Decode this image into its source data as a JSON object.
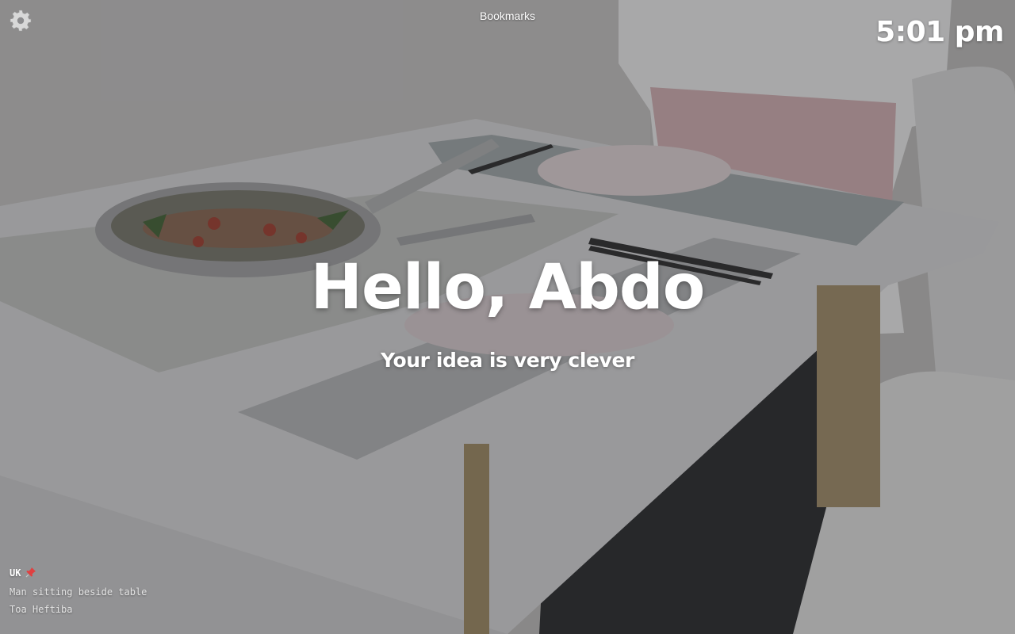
{
  "header": {
    "bookmarks_label": "Bookmarks",
    "settings_icon": "gear-icon",
    "clock": "5:01 pm"
  },
  "main": {
    "greeting": "Hello, Abdo",
    "message": "Your idea is very clever"
  },
  "photo_info": {
    "location": "UK",
    "location_icon": "pin-icon",
    "description": "Man sitting beside table",
    "author": "Toa Heftiba"
  },
  "colors": {
    "text": "#ffffff",
    "pin": "#e04040"
  }
}
